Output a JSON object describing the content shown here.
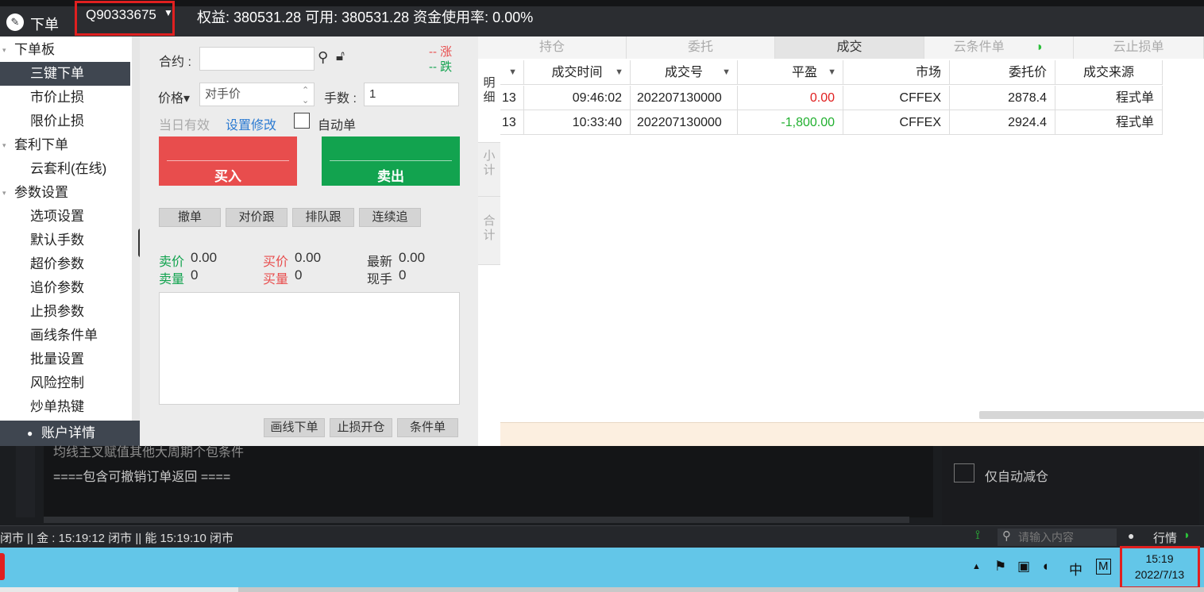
{
  "topbar": {
    "title": "下单",
    "account_id": "Q90333675",
    "equity_line": "权益: 380531.28   可用: 380531.28   资金使用率: 0.00%"
  },
  "nav": {
    "groups": [
      {
        "label": "下单板",
        "items": [
          "三键下单",
          "市价止损",
          "限价止损"
        ]
      },
      {
        "label": "套利下单",
        "items": [
          "云套利(在线)"
        ]
      },
      {
        "label": "参数设置",
        "items": [
          "选项设置",
          "默认手数",
          "超价参数",
          "追价参数",
          "止损参数",
          "画线条件单",
          "批量设置",
          "风险控制",
          "炒单热键"
        ]
      }
    ],
    "account_detail": "账户详情"
  },
  "order": {
    "contract_label": "合约 :",
    "contract_value": "",
    "price_label": "价格▾",
    "price_value": "对手价",
    "qty_label": "手数 :",
    "qty_value": "1",
    "valid_today": "当日有效",
    "modify_settings": "设置修改",
    "auto_order": "自动单",
    "rise": "-- 涨",
    "fall": "-- 跌",
    "buy": "买入",
    "sell": "卖出",
    "small_buttons": [
      "撤单",
      "对价跟",
      "排队跟",
      "连续追"
    ],
    "ask_label": "卖价",
    "ask_value": "0.00",
    "ask_vol_label": "卖量",
    "ask_vol_value": "0",
    "bid_label": "买价",
    "bid_value": "0.00",
    "bid_vol_label": "买量",
    "bid_vol_value": "0",
    "last_label": "最新",
    "last_value": "0.00",
    "cur_label": "现手",
    "cur_value": "0",
    "bottom_buttons": [
      "画线下单",
      "止损开仓",
      "条件单"
    ]
  },
  "tabs": [
    "持仓",
    "委托",
    "成交",
    "云条件单",
    "云止损单"
  ],
  "vtabs": [
    "明细",
    "小计",
    "合计"
  ],
  "table": {
    "headers": [
      "成交时间",
      "成交号",
      "平盈",
      "市场",
      "委托价",
      "成交来源"
    ],
    "rows": [
      {
        "date": "13",
        "time": "09:46:02",
        "id": "202207130000",
        "pnl": "0.00",
        "market": "CFFEX",
        "price": "2878.4",
        "source": "程式单"
      },
      {
        "date": "13",
        "time": "10:33:40",
        "id": "202207130000",
        "pnl": "-1,800.00",
        "market": "CFFEX",
        "price": "2924.4",
        "source": "程式单"
      }
    ]
  },
  "background": {
    "line1": "均线主叉赋值其他大周期个包条件",
    "line2": "====包含可撤销订单返回 ====",
    "auto_reduce": "仅自动减仓"
  },
  "status": {
    "text": "闭市 || 金 : 15:19:12  闭市 || 能 15:19:10  闭市",
    "search_placeholder": "请输入内容",
    "market_label": "行情"
  },
  "taskbar": {
    "time": "15:19",
    "date": "2022/7/13",
    "ime": "中",
    "m": "M"
  },
  "colors": {
    "red": "#e84d4d",
    "green": "#12a34f",
    "pnl_neg": "#22b030",
    "pnl_zero": "#e02020"
  }
}
